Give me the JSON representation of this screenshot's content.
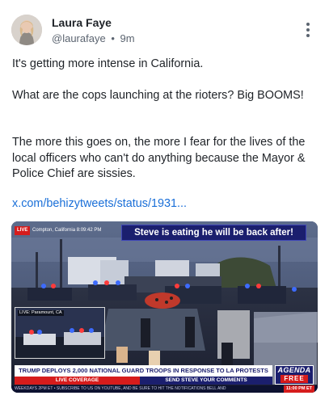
{
  "author": {
    "name": "Laura Faye",
    "handle": "@laurafaye",
    "separator": "•",
    "time": "9m"
  },
  "post": {
    "paragraph1": "It's getting more intense in California.",
    "paragraph2": "What are the cops launching at the rioters? Big BOOMS!",
    "paragraph3": "The more this goes on, the more I fear for the lives of the local officers who can't do anything because the Mayor & Police Chief are sissies.",
    "link": "x.com/behizytweets/status/1931..."
  },
  "video": {
    "live_badge": "LIVE",
    "location": "Compton, California 8:09:42 PM",
    "top_banner": "Steve is eating he will be back after!",
    "pip_label": "LIVE: Paramount, CA",
    "headline": "TRUMP DEPLOYS 2,000 NATIONAL GUARD TROOPS IN RESPONSE TO LA PROTESTS",
    "live_coverage": "LIVE COVERAGE",
    "send_comments": "SEND STEVE YOUR COMMENTS",
    "ticker": "WEEKDAYS 2PM ET • SUBSCRIBE TO US ON YOUTUBE, AND BE SURE TO HIT THE NOTIFICATIONS BELL AND",
    "ticker_time": "11:00 PM ET",
    "logo_top": "AGENDA",
    "logo_bottom": "FREE"
  },
  "colors": {
    "link": "#1a6fd8",
    "news_red": "#d61c1c",
    "news_navy": "#1b1f6e"
  },
  "icons": {
    "menu": "more-vertical-icon"
  }
}
